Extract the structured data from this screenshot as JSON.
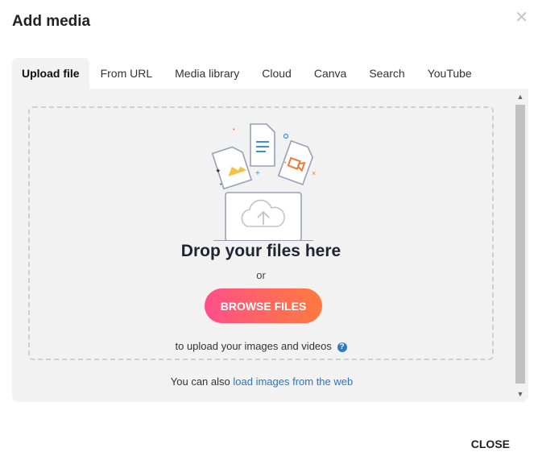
{
  "dialog": {
    "title": "Add media",
    "close_icon": "close-x-icon",
    "close_label": "CLOSE"
  },
  "tabs": [
    {
      "label": "Upload file",
      "active": true
    },
    {
      "label": "From URL"
    },
    {
      "label": "Media library"
    },
    {
      "label": "Cloud"
    },
    {
      "label": "Canva"
    },
    {
      "label": "Search"
    },
    {
      "label": "YouTube"
    }
  ],
  "dropzone": {
    "heading": "Drop your files here",
    "or": "or",
    "browse_label": "BROWSE FILES",
    "note": "to upload your images and videos",
    "help_icon": "question-circle-icon",
    "illustration_icon": "laptop-cloud-upload-icon"
  },
  "web": {
    "prefix": "You can also",
    "link": "load images from the web"
  },
  "colors": {
    "accent_start": "#ff4f8b",
    "accent_end": "#ff7a3d",
    "link": "#2a75c0",
    "panel_bg": "#f2f2f2"
  }
}
